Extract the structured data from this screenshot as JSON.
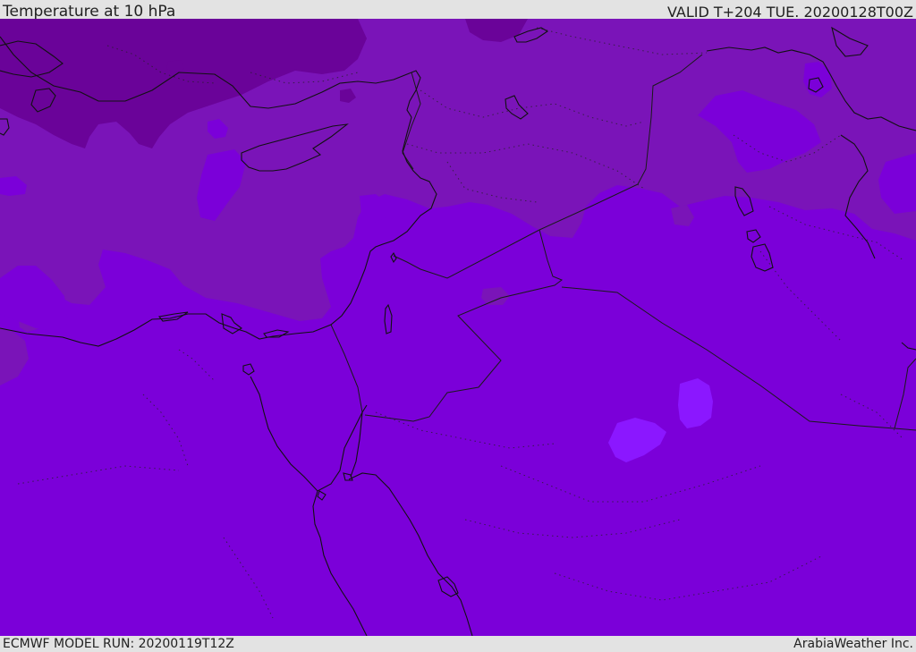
{
  "header": {
    "title": "Temperature at 10 hPa",
    "valid": "VALID T+204 TUE. 20200128T00Z"
  },
  "footer": {
    "model_run": "ECMWF MODEL RUN: 20200119T12Z",
    "credit": "ArabiaWeather Inc."
  },
  "colors": {
    "base_field": "#7b00d9",
    "middle_band": "#7a14b8",
    "cold_band": "#6a0399",
    "warm_spots": "#8b17ff",
    "coastline": "#111111",
    "border": "#1a1a1a"
  }
}
